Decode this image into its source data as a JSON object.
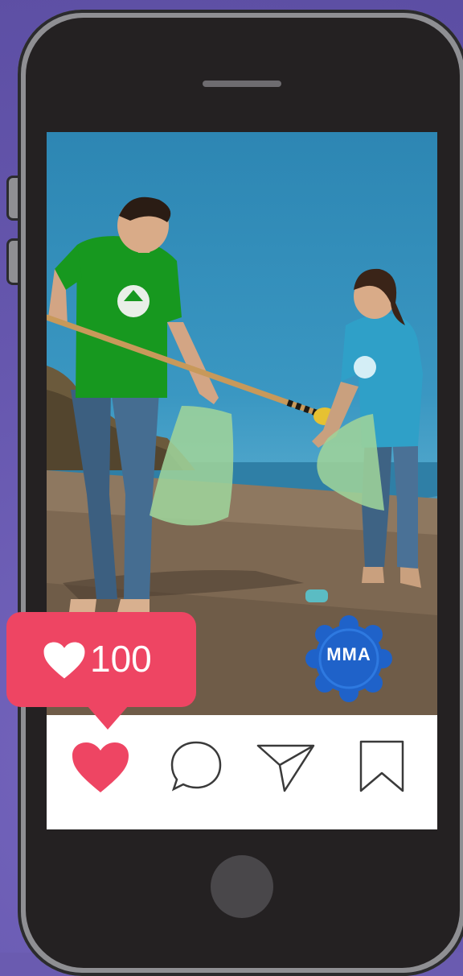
{
  "post": {
    "likes_count": "100",
    "brand_badge_text": "MMA"
  },
  "actions": {
    "like_icon": "heart-filled-icon",
    "comment_icon": "comment-bubble-icon",
    "share_icon": "paper-plane-icon",
    "save_icon": "bookmark-icon"
  },
  "colors": {
    "like_accent": "#ee4563",
    "badge_blue": "#1f62c9",
    "background_purple": "#6a5bb0"
  }
}
